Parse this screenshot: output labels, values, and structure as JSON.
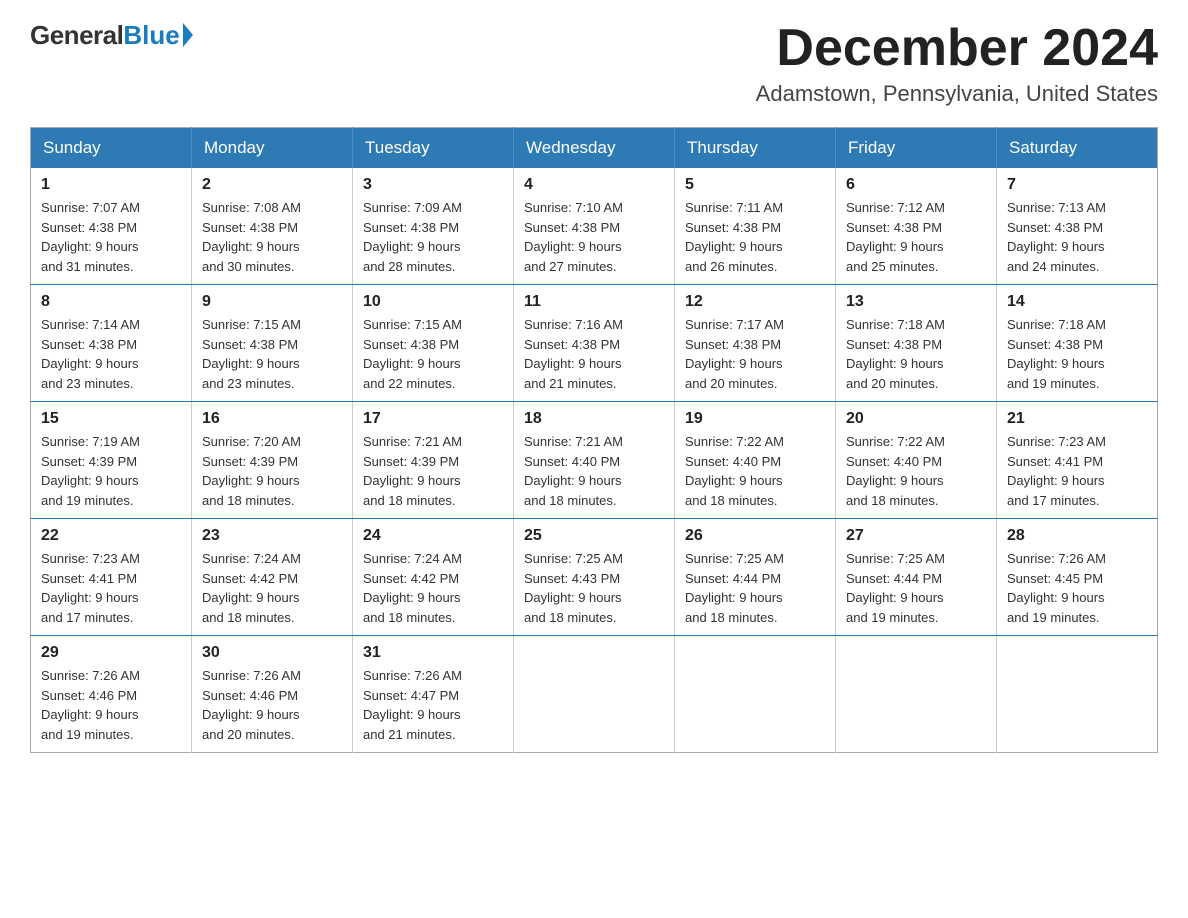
{
  "logo": {
    "general": "General",
    "blue": "Blue"
  },
  "title": {
    "month_year": "December 2024",
    "location": "Adamstown, Pennsylvania, United States"
  },
  "weekdays": [
    "Sunday",
    "Monday",
    "Tuesday",
    "Wednesday",
    "Thursday",
    "Friday",
    "Saturday"
  ],
  "weeks": [
    [
      {
        "day": "1",
        "sunrise": "7:07 AM",
        "sunset": "4:38 PM",
        "daylight": "9 hours and 31 minutes."
      },
      {
        "day": "2",
        "sunrise": "7:08 AM",
        "sunset": "4:38 PM",
        "daylight": "9 hours and 30 minutes."
      },
      {
        "day": "3",
        "sunrise": "7:09 AM",
        "sunset": "4:38 PM",
        "daylight": "9 hours and 28 minutes."
      },
      {
        "day": "4",
        "sunrise": "7:10 AM",
        "sunset": "4:38 PM",
        "daylight": "9 hours and 27 minutes."
      },
      {
        "day": "5",
        "sunrise": "7:11 AM",
        "sunset": "4:38 PM",
        "daylight": "9 hours and 26 minutes."
      },
      {
        "day": "6",
        "sunrise": "7:12 AM",
        "sunset": "4:38 PM",
        "daylight": "9 hours and 25 minutes."
      },
      {
        "day": "7",
        "sunrise": "7:13 AM",
        "sunset": "4:38 PM",
        "daylight": "9 hours and 24 minutes."
      }
    ],
    [
      {
        "day": "8",
        "sunrise": "7:14 AM",
        "sunset": "4:38 PM",
        "daylight": "9 hours and 23 minutes."
      },
      {
        "day": "9",
        "sunrise": "7:15 AM",
        "sunset": "4:38 PM",
        "daylight": "9 hours and 23 minutes."
      },
      {
        "day": "10",
        "sunrise": "7:15 AM",
        "sunset": "4:38 PM",
        "daylight": "9 hours and 22 minutes."
      },
      {
        "day": "11",
        "sunrise": "7:16 AM",
        "sunset": "4:38 PM",
        "daylight": "9 hours and 21 minutes."
      },
      {
        "day": "12",
        "sunrise": "7:17 AM",
        "sunset": "4:38 PM",
        "daylight": "9 hours and 20 minutes."
      },
      {
        "day": "13",
        "sunrise": "7:18 AM",
        "sunset": "4:38 PM",
        "daylight": "9 hours and 20 minutes."
      },
      {
        "day": "14",
        "sunrise": "7:18 AM",
        "sunset": "4:38 PM",
        "daylight": "9 hours and 19 minutes."
      }
    ],
    [
      {
        "day": "15",
        "sunrise": "7:19 AM",
        "sunset": "4:39 PM",
        "daylight": "9 hours and 19 minutes."
      },
      {
        "day": "16",
        "sunrise": "7:20 AM",
        "sunset": "4:39 PM",
        "daylight": "9 hours and 18 minutes."
      },
      {
        "day": "17",
        "sunrise": "7:21 AM",
        "sunset": "4:39 PM",
        "daylight": "9 hours and 18 minutes."
      },
      {
        "day": "18",
        "sunrise": "7:21 AM",
        "sunset": "4:40 PM",
        "daylight": "9 hours and 18 minutes."
      },
      {
        "day": "19",
        "sunrise": "7:22 AM",
        "sunset": "4:40 PM",
        "daylight": "9 hours and 18 minutes."
      },
      {
        "day": "20",
        "sunrise": "7:22 AM",
        "sunset": "4:40 PM",
        "daylight": "9 hours and 18 minutes."
      },
      {
        "day": "21",
        "sunrise": "7:23 AM",
        "sunset": "4:41 PM",
        "daylight": "9 hours and 17 minutes."
      }
    ],
    [
      {
        "day": "22",
        "sunrise": "7:23 AM",
        "sunset": "4:41 PM",
        "daylight": "9 hours and 17 minutes."
      },
      {
        "day": "23",
        "sunrise": "7:24 AM",
        "sunset": "4:42 PM",
        "daylight": "9 hours and 18 minutes."
      },
      {
        "day": "24",
        "sunrise": "7:24 AM",
        "sunset": "4:42 PM",
        "daylight": "9 hours and 18 minutes."
      },
      {
        "day": "25",
        "sunrise": "7:25 AM",
        "sunset": "4:43 PM",
        "daylight": "9 hours and 18 minutes."
      },
      {
        "day": "26",
        "sunrise": "7:25 AM",
        "sunset": "4:44 PM",
        "daylight": "9 hours and 18 minutes."
      },
      {
        "day": "27",
        "sunrise": "7:25 AM",
        "sunset": "4:44 PM",
        "daylight": "9 hours and 19 minutes."
      },
      {
        "day": "28",
        "sunrise": "7:26 AM",
        "sunset": "4:45 PM",
        "daylight": "9 hours and 19 minutes."
      }
    ],
    [
      {
        "day": "29",
        "sunrise": "7:26 AM",
        "sunset": "4:46 PM",
        "daylight": "9 hours and 19 minutes."
      },
      {
        "day": "30",
        "sunrise": "7:26 AM",
        "sunset": "4:46 PM",
        "daylight": "9 hours and 20 minutes."
      },
      {
        "day": "31",
        "sunrise": "7:26 AM",
        "sunset": "4:47 PM",
        "daylight": "9 hours and 21 minutes."
      },
      null,
      null,
      null,
      null
    ]
  ],
  "labels": {
    "sunrise": "Sunrise:",
    "sunset": "Sunset:",
    "daylight": "Daylight:"
  }
}
